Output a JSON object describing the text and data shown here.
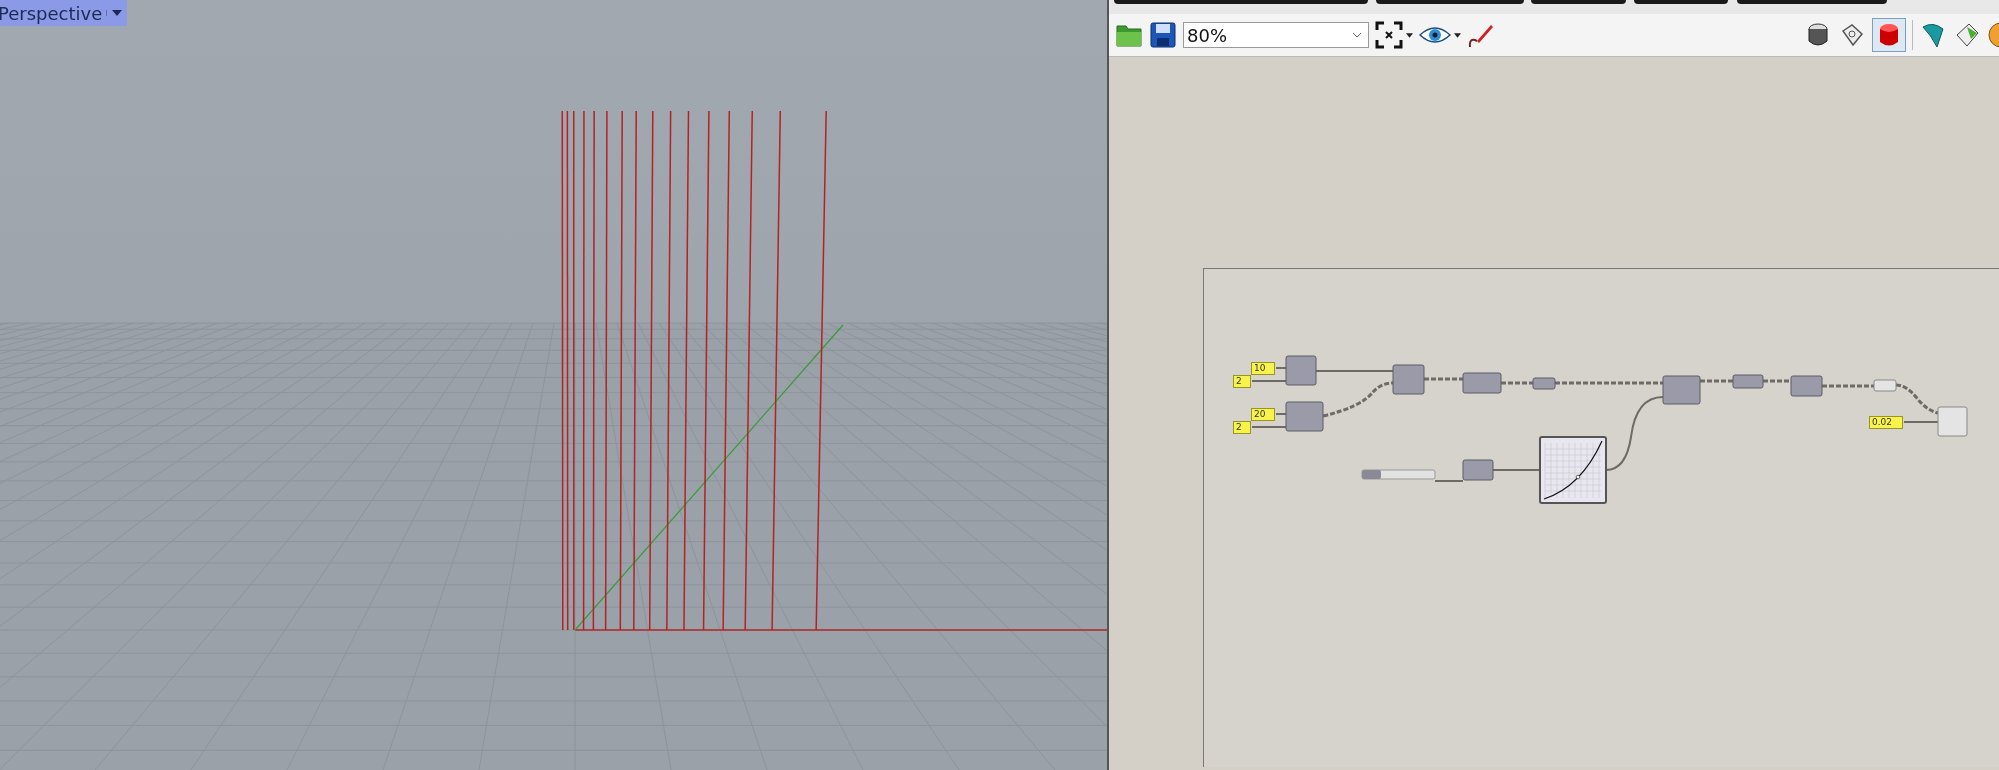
{
  "viewport": {
    "label": "Perspective"
  },
  "toolbar": {
    "zoom": "80%"
  },
  "canvas": {
    "panels": [
      {
        "value": "10"
      },
      {
        "value": "2"
      },
      {
        "value": "20"
      },
      {
        "value": "2"
      },
      {
        "value": "0.02"
      }
    ],
    "slider": {
      "level": 0.26
    }
  }
}
